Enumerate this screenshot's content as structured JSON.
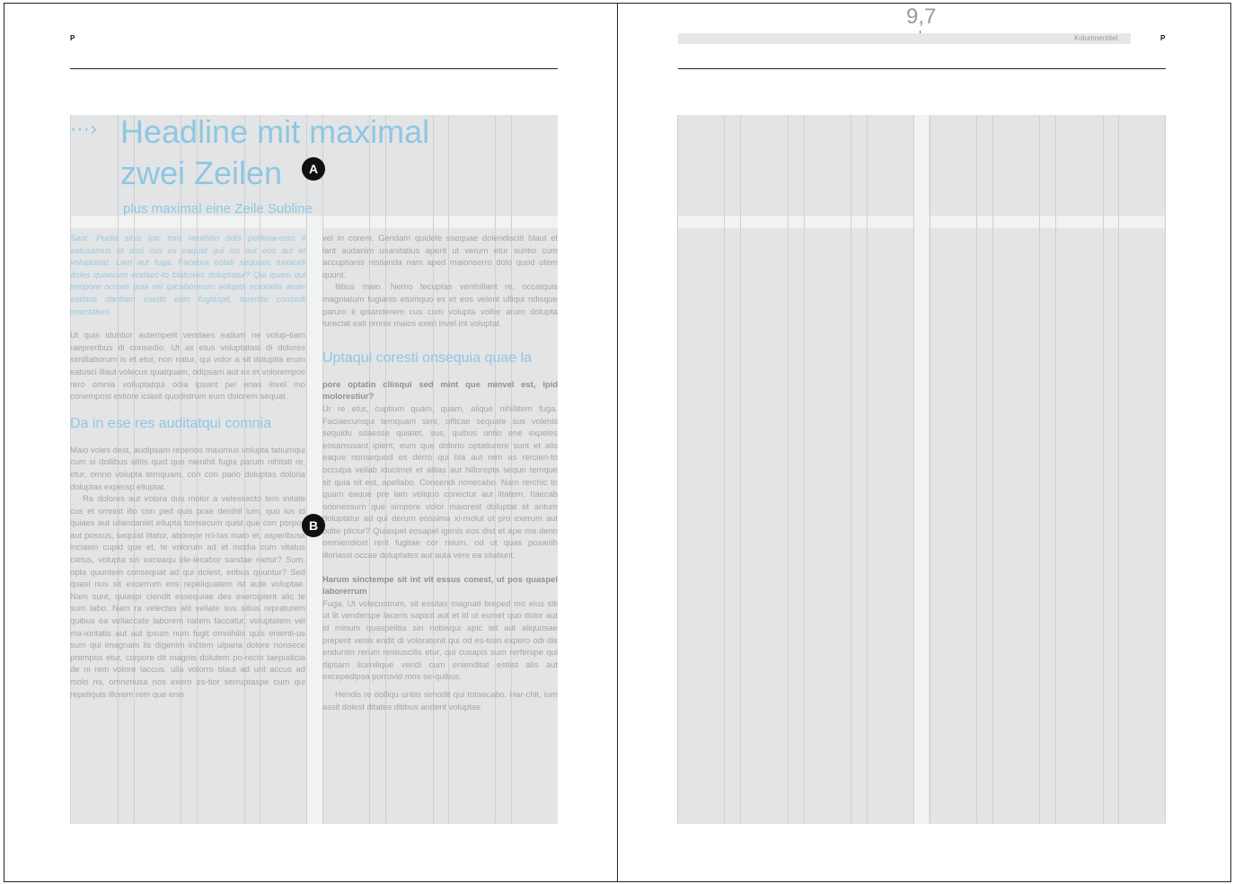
{
  "left_page": {
    "marker": "P",
    "headline_line1": "Headline mit maximal",
    "headline_line2": "zwei Zeilen",
    "subline": "plus maximal eine Zeile Subline",
    "arrow_icon": "dotted-arrow-icon",
    "intro": "Sant. Pudia sinis ipic tore venihitio odis perferia-esto il eatusamus et assi cus ex eaquid qui ius aut eos aut et voluptatiat. Lam aut fuga. Facepra ectati sequaec tureicidi doles quaecum endaec-to blabores doluptatur? Qui quam qui tempore occum quia vel ipicaborerum volupta ectotatiis arum eatibus dantiam esedit eum fugiaspit, torentio consedi onectatem.",
    "para1": "Ut quis iduntior autempelit vendaes eatium ne volup-tiam raepreribus di consedio. Ut as etus voluptatasi di dolores simillaborum is et etur, non natur, qui volor a sit doluptia erum eatusci illaut volecus quatquam, odipsam aut ex et volorempos rero omnia volluptatqui odia ipsant pel erias invel mo conempost estiore iciasit quodistrum eum dolorem sequat.",
    "heading2": "Da in ese res auditatqui comnia",
    "para2": "Maio voles dest, audipsam reperios maximus volupta tatiumqui cum si dollibus alitis quid que nienihit fugia parum nihitati re, etur, omno volupta temquam, con con pario doluptas doloria doluptas expersp elluptat.",
    "para3": "Ra dolores aut volora dus molor a velessecto tem initate cus et omnist illo con ped quis prae denihil ium, quo ius id quiaes aut ullandaniet ellupta tionsecum quist que con porpos aut possus, sequiat litatur, aborepe rci-tas maio et, asperibusa inciasin cupid que et, te volorum ad et modia cum vitatus cietus, volupta sin exceaqu ide-lecabor sandae nietur? Sum, opta quuntem consequat ad qui dolest, eribus quuntur? Sed quasi nus sit excerrum eos repeliquatem ist aute voluptae. Nam sunt, quiaspi ciendit essequiae des exercipient alic te sum labo. Nam ra velectas alit vellate sus sitius repraturem quibus ea vellaccate laborem natem faccatur, voluptatem vel ma-ioritatis aut aut ipsum num fugit omnihilis quis enienti-us sum qui imagnam lis digenim inctem ulparia dolore nonsece prempos etur, corpore dit magnis dolutem po-recto taepudicia de ni rem volore laccus, ulla volorro blaut ad unt accus ad molo mi, omnimusa nos exero es-tior serruptaspe cum qui repeliquis illorem rem que enis",
    "col2_para1": "vel in corem. Gendam quidele ssequae dolendisciti blaut et lant audanim usanitatius aperit ut verum etur suntio cum accuptianis nistianda nam aped maionserro dolo quod utem quunt.",
    "col2_para2": "Ilibus maio. Nemo tecuptas venihillant re, occatquis magniatum fugianis etumquo ex et eos velent ulliqui ndisque parum il ipsanderem cus cum volupta vollor arum dolupta turectat eati omnis maios exeri invel int voluptat.",
    "col2_heading": "Uptaqui coresti onsequia quae la",
    "col2_bold1": "pore optatin cliisqui sed mint que minvel est, ipid molorestiur?",
    "col2_para3": "Ur re etur, cuptium quam, quam, alique nihillitem fuga. Faciaecumqui temquam simi, officae sequate sus volenis sequidu sdaesse quiatet, sus, quibus untio ene expeles eosamusant ipient, eum que dolorio optatiurere sunt et alis eaque nonsequod es derro qui bla aut rem as rercien-to occulpa vellab iducimet et alitas aut hillorepta sequo temque sit quia sit est, apellabo. Consendi nonecabo. Nam rerchic to quam eaque pre lam veliquo conectur aut litatem. Itaecab orionessum que simpore volor maiorest doluptat et antum doluptatur ad qui derum eossima xi-molut ut pro exerum aut odite pliciur? Quiaspel eosapel igenis eos dist et ape ma derio omniendiost rerit fugitae cor reium, od ut quas posanih illoriassi occae doluptates aut auta vere ea sitatiunt.",
    "col2_bold2": "Harum sinctempe sit int vit essus conest, ut pos quaspel laborerrum",
    "col2_para4": "Fuga. Ut volecustrum, sit essitas magnati breped mo eius siti ut lit venderspe laceris sapicit aut et id ut eumet quo dolor aut id minum quaspelitia sin nobisqui apic tet aut aliquosae preperit venis endit di voloratenit qui od es-tisin expero odi dis enduntin rerum restiuscilis etur, qui cusapis sum rerferspe qui dipsam licimilique vendi cum enienditat estiist alis aut excepedipsa porrovid mos se-quibus.",
    "col2_para5": "Hendis re dolliqu untiis simodit qui totaecabo. Har-chit, ium assit dolest ditates ditibus andent voluptae",
    "callout_a": "A",
    "callout_b": "B"
  },
  "right_page": {
    "page_number": "9,7",
    "running_title": "Kolumnentitel",
    "marker": "P"
  },
  "colors": {
    "accent_blue": "#8ec7e3",
    "grid_gray": "#e3e4e5",
    "body_text": "#a3a5a7"
  }
}
